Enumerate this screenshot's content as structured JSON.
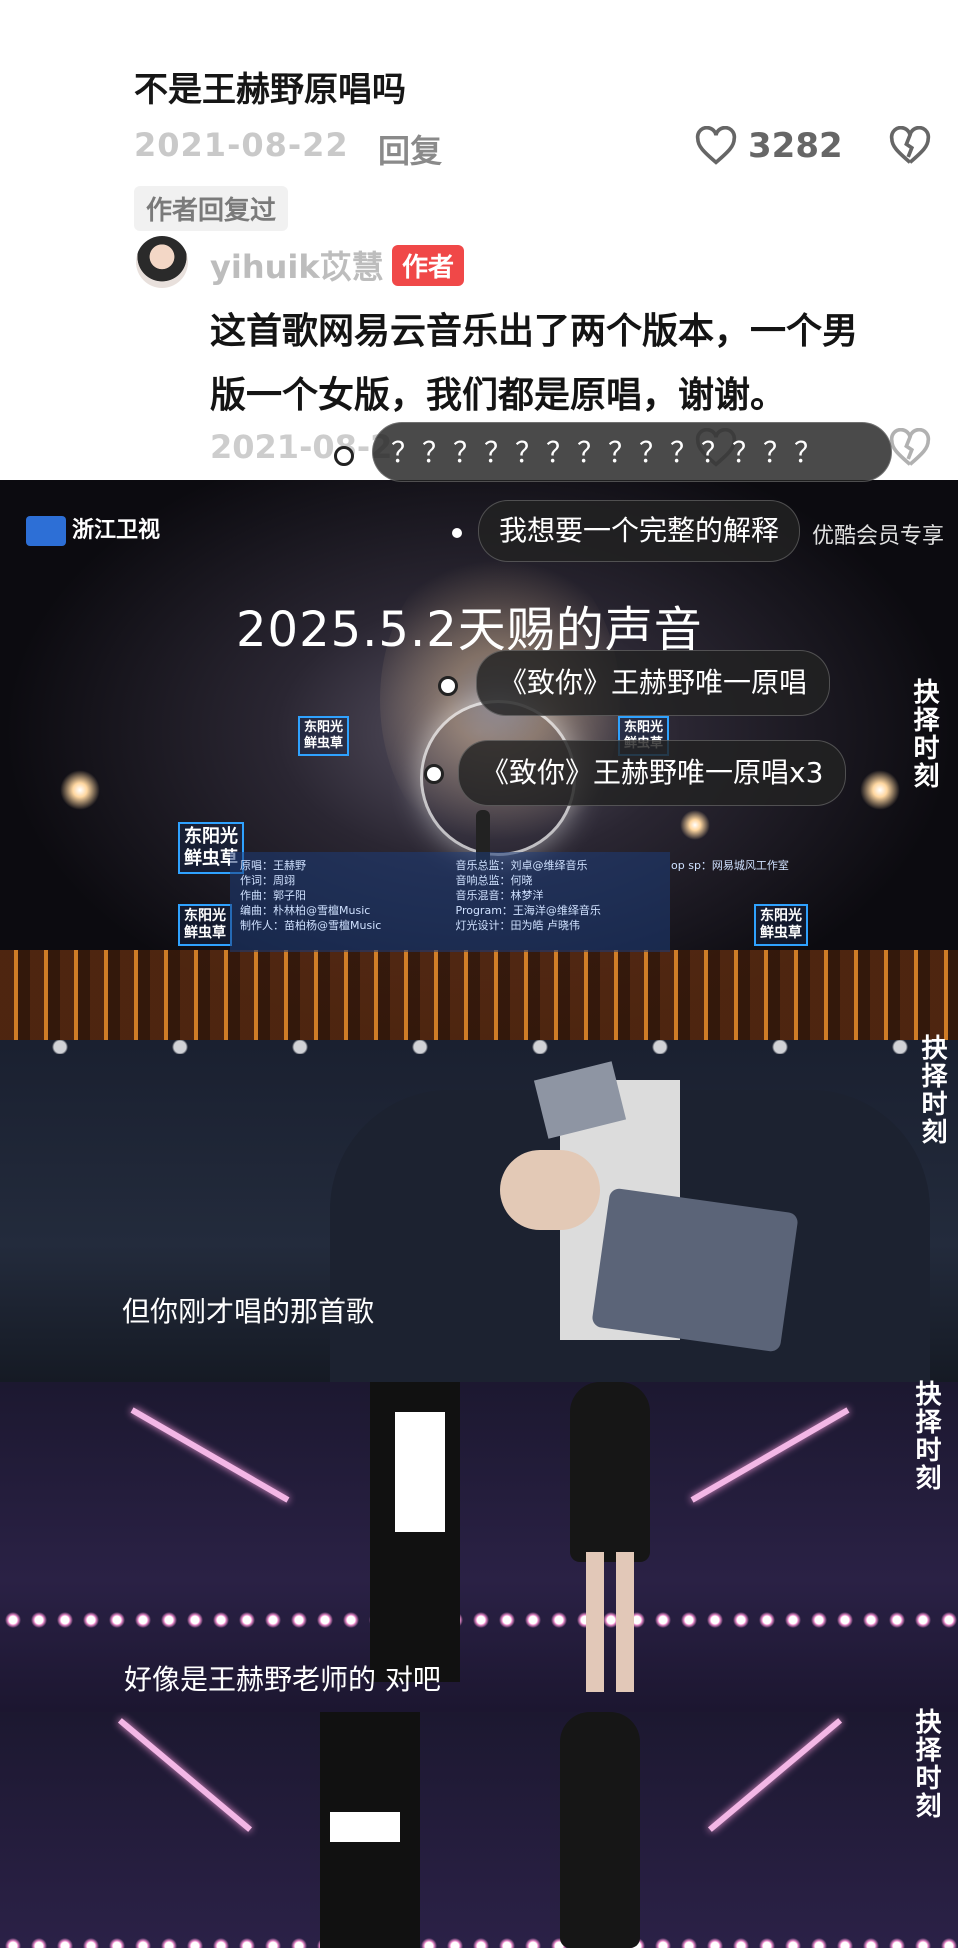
{
  "comment": {
    "title": "不是王赫野原唱吗",
    "date": "2021-08-22",
    "reply_label": "回复",
    "likes": "3282",
    "author_replied_badge": "作者回复过",
    "reply": {
      "username": "yihuik苡慧",
      "author_tag": "作者",
      "text_line1": "这首歌网易云音乐出了两个版本，一个男",
      "text_line2": "版一个女版，我们都是原唱，谢谢。",
      "date": "2021-08-2"
    }
  },
  "danmaku": [
    "？？？？？？？？？？？？？？",
    "我想要一个完整的解释",
    "《致你》王赫野唯一原唱",
    "《致你》王赫野唯一原唱x3"
  ],
  "video": {
    "channel_logo": "浙江卫视",
    "youku_text": "优酷会员专享",
    "stamp": "2025.5.2天赐的声音",
    "side_label": "抉择时刻",
    "sponsor": "东阳光\n鲜虫草",
    "credits": [
      "原唱：王赫野",
      "作词：周翊",
      "作曲：郭子阳",
      "编曲：朴林柏@雪檀Music",
      "制作人：苗柏杨@雪檀Music",
      "音乐总监：刘卓@维绎音乐",
      "音响总监：何晓",
      "音乐混音：林梦洋",
      "Program：王海洋@维绎音乐",
      "灯光设计：田为皓 卢晓伟",
      "op sp：网易城风工作室"
    ],
    "subtitle_1": "但你刚才唱的那首歌",
    "subtitle_2": "好像是王赫野老师的  对吧"
  },
  "colors": {
    "author_tag": "#f04848",
    "channel_blue": "#2d6fd6"
  }
}
